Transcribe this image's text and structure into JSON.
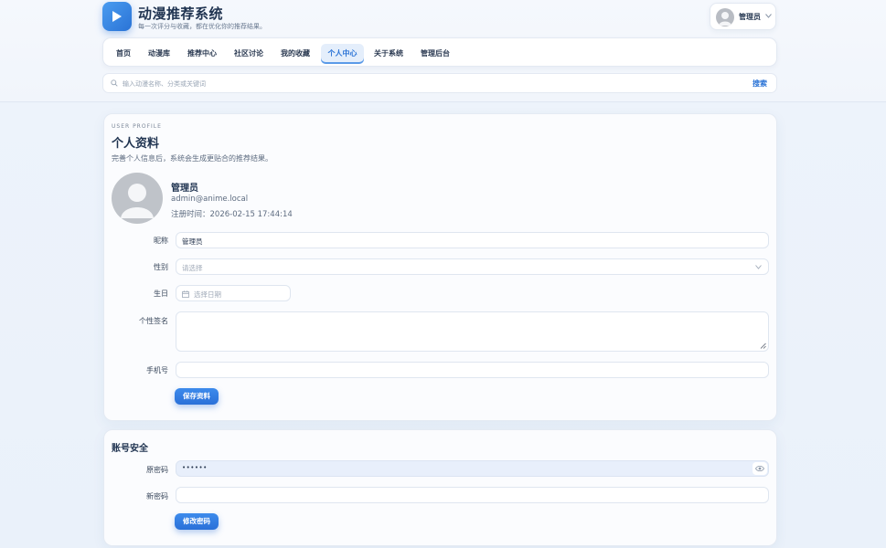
{
  "brand": {
    "title": "动漫推荐系统",
    "subtitle": "每一次评分与收藏，都在优化你的推荐结果。",
    "logo_icon": "play-icon"
  },
  "user_menu": {
    "name": "管理员",
    "avatar_icon": "user-avatar-icon",
    "chevron_icon": "chevron-down-icon"
  },
  "nav": {
    "items": [
      {
        "label": "首页",
        "active": false
      },
      {
        "label": "动漫库",
        "active": false
      },
      {
        "label": "推荐中心",
        "active": false
      },
      {
        "label": "社区讨论",
        "active": false
      },
      {
        "label": "我的收藏",
        "active": false
      },
      {
        "label": "个人中心",
        "active": true
      },
      {
        "label": "关于系统",
        "active": false
      },
      {
        "label": "管理后台",
        "active": false
      }
    ]
  },
  "search": {
    "placeholder": "输入动漫名称、分类或关键词",
    "button": "搜索"
  },
  "profile": {
    "eyebrow": "USER PROFILE",
    "title": "个人资料",
    "description": "完善个人信息后，系统会生成更贴合的推荐结果。",
    "name": "管理员",
    "email": "admin@anime.local",
    "registered": "注册时间：2026-02-15 17:44:14",
    "form": {
      "nickname_label": "昵称",
      "nickname_value": "管理员",
      "gender_label": "性别",
      "gender_placeholder": "请选择",
      "birthday_label": "生日",
      "birthday_placeholder": "选择日期",
      "signature_label": "个性签名",
      "signature_value": "",
      "phone_label": "手机号",
      "phone_value": "",
      "save_button": "保存资料"
    }
  },
  "security": {
    "title": "账号安全",
    "old_password_label": "原密码",
    "old_password_value": "••••••",
    "new_password_label": "新密码",
    "new_password_value": "",
    "change_button": "修改密码"
  },
  "colors": {
    "accent": "#2a73d6",
    "page_bg": "#eaf1fa",
    "active_tab_bg": "#e4eefb"
  }
}
